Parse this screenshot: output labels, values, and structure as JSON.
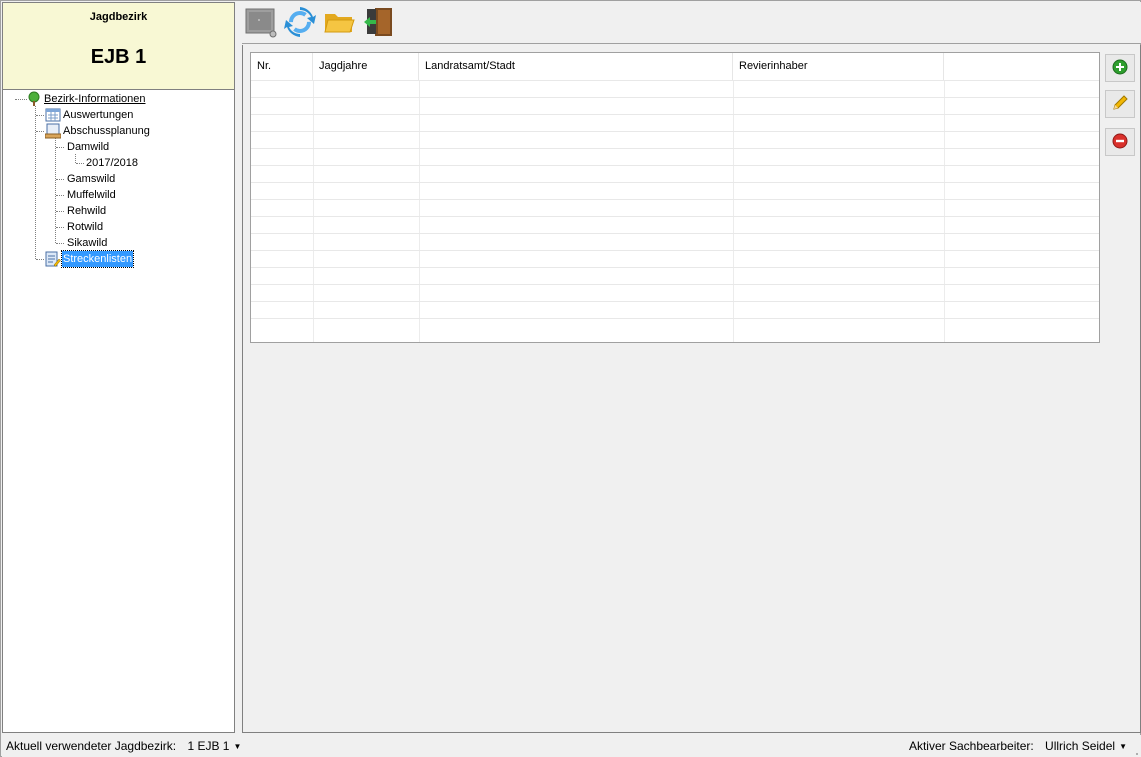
{
  "district": {
    "caption": "Jagdbezirk",
    "name": "EJB 1"
  },
  "tree": {
    "root": "Bezirk-Informationen",
    "auswertungen": "Auswertungen",
    "abschussplanung": "Abschussplanung",
    "damwild": "Damwild",
    "year": "2017/2018",
    "gamswild": "Gamswild",
    "muffelwild": "Muffelwild",
    "rehwild": "Rehwild",
    "rotwild": "Rotwild",
    "sikawild": "Sikawild",
    "streckenlisten": "Streckenlisten"
  },
  "toolbar": {
    "icons": [
      "screen-icon",
      "refresh-icon",
      "open-folder-icon",
      "exit-door-icon"
    ]
  },
  "grid": {
    "columns": [
      "Nr.",
      "Jagdjahre",
      "Landratsamt/Stadt",
      "Revierinhaber",
      ""
    ],
    "rows": []
  },
  "side_buttons": {
    "icons": [
      "add-icon",
      "edit-pencil-icon",
      "delete-icon"
    ]
  },
  "statusbar": {
    "left_label": "Aktuell verwendeter Jagdbezirk:",
    "left_value": "1 EJB 1",
    "right_label": "Aktiver Sachbearbeiter:",
    "right_value": "Ullrich Seidel"
  },
  "colors": {
    "header_bg": "#f8f8d4",
    "selection": "#3399ff",
    "add_green": "#2e9e2e",
    "delete_red": "#d9302b",
    "refresh_blue": "#2a8fd6",
    "folder_yellow": "#f5c542"
  }
}
